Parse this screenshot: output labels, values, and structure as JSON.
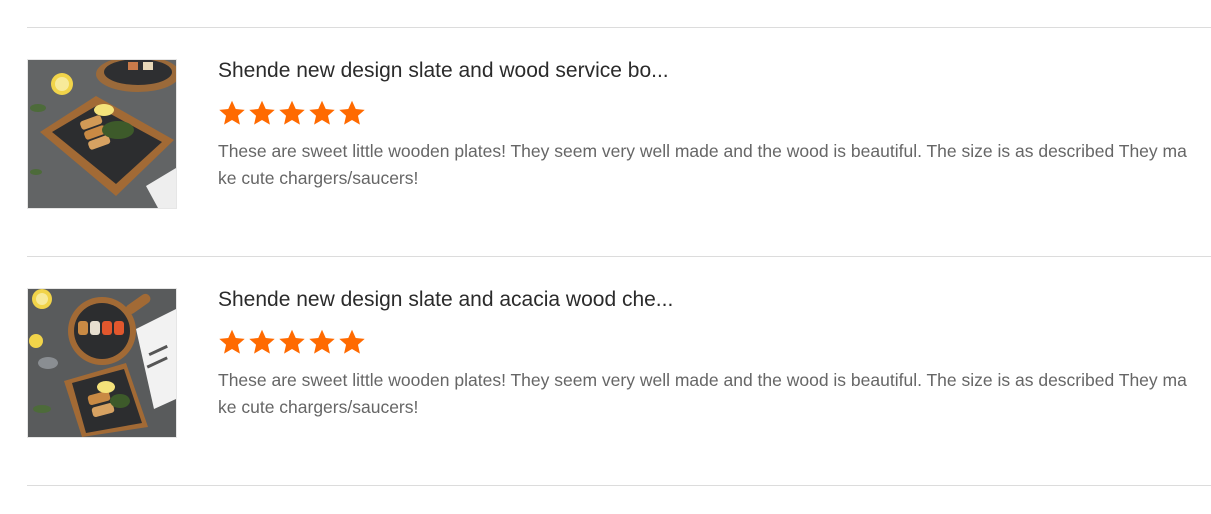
{
  "reviews": [
    {
      "product_title": "Shende new design slate and wood service bo...",
      "rating": 5,
      "text": "These are sweet little wooden plates! They seem very well made and the wood is beautiful. The size is as described They make cute chargers/saucers!"
    },
    {
      "product_title": "Shende new design slate and acacia wood che...",
      "rating": 5,
      "text": "These are sweet little wooden plates! They seem very well made and the wood is beautiful. The size is as described They make cute chargers/saucers!"
    }
  ],
  "colors": {
    "star": "#ff6a00",
    "divider": "#dcdcdc",
    "title": "#2b2b2b",
    "body": "#666666"
  }
}
